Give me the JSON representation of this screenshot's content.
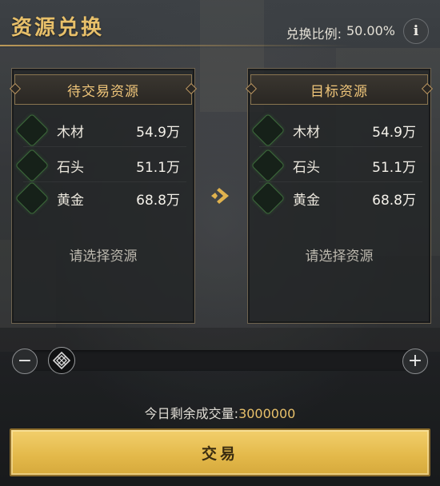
{
  "header": {
    "title": "资源兑换",
    "ratio_label": "兑换比例:",
    "ratio_value": "50.00%",
    "info_label": "i"
  },
  "source_panel": {
    "title": "待交易资源",
    "items": [
      {
        "name": "木材",
        "amount": "54.9万"
      },
      {
        "name": "石头",
        "amount": "51.1万"
      },
      {
        "name": "黄金",
        "amount": "68.8万"
      }
    ],
    "placeholder": "请选择资源"
  },
  "target_panel": {
    "title": "目标资源",
    "items": [
      {
        "name": "木材",
        "amount": "54.9万"
      },
      {
        "name": "石头",
        "amount": "51.1万"
      },
      {
        "name": "黄金",
        "amount": "68.8万"
      }
    ],
    "placeholder": "请选择资源"
  },
  "slider": {
    "minus_label": "−",
    "plus_label": "+",
    "value_fraction": 0.0
  },
  "daily": {
    "label": "今日剩余成交量:",
    "value": "3000000"
  },
  "trade_button": {
    "label": "交易"
  },
  "colors": {
    "accent_gold": "#e8c06a",
    "button_gold": "#e3b849",
    "icon_green": "#3c6a3a"
  },
  "icons": {
    "info": "info-icon",
    "arrow": "arrow-right-icon",
    "slider_knob": "diamond-knot-icon",
    "resource_slot": "resource-slot-icon"
  }
}
